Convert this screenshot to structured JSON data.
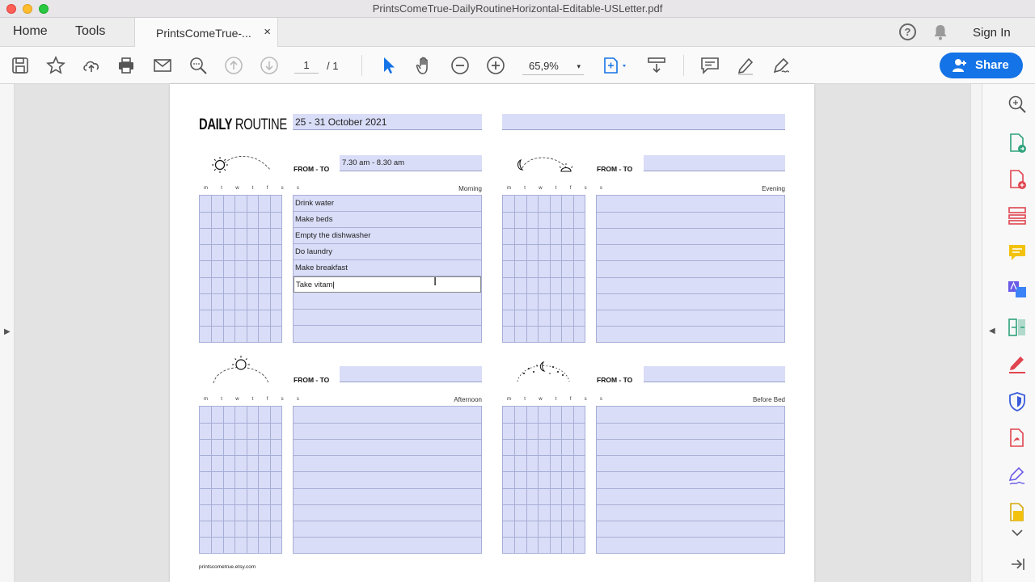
{
  "window": {
    "title": "PrintsComeTrue-DailyRoutineHorizontal-Editable-USLetter.pdf"
  },
  "tabs": {
    "home": "Home",
    "tools": "Tools",
    "document": "PrintsComeTrue-...",
    "close": "×"
  },
  "header": {
    "help": "?",
    "sign_in": "Sign In"
  },
  "toolbar": {
    "page_current": "1",
    "page_total": "/ 1",
    "zoom": "65,9%",
    "zoom_caret": "▾",
    "share": "Share"
  },
  "panes": {
    "left_arrow": "▶",
    "right_arrow": "◀"
  },
  "document": {
    "title_bold": "DAILY",
    "title_light": "ROUTINE",
    "date_range": "25 - 31 October 2021",
    "header_field_right": "",
    "from_to_label": "FROM - TO",
    "day_letters": "m t w t f s s",
    "footer": "printscometrue.etsy.com",
    "sections": {
      "morning": {
        "label": "Morning",
        "time": "7.30 am - 8.30 am",
        "items": [
          "Drink water",
          "Make beds",
          "Empty the dishwasher",
          "Do laundry",
          "Make breakfast",
          "Take vitam"
        ]
      },
      "evening": {
        "label": "Evening",
        "time": ""
      },
      "afternoon": {
        "label": "Afternoon",
        "time": ""
      },
      "before_bed": {
        "label": "Before Bed",
        "time": ""
      }
    }
  },
  "colors": {
    "field_fill": "#d9ddf7",
    "accent": "#1473e6"
  }
}
